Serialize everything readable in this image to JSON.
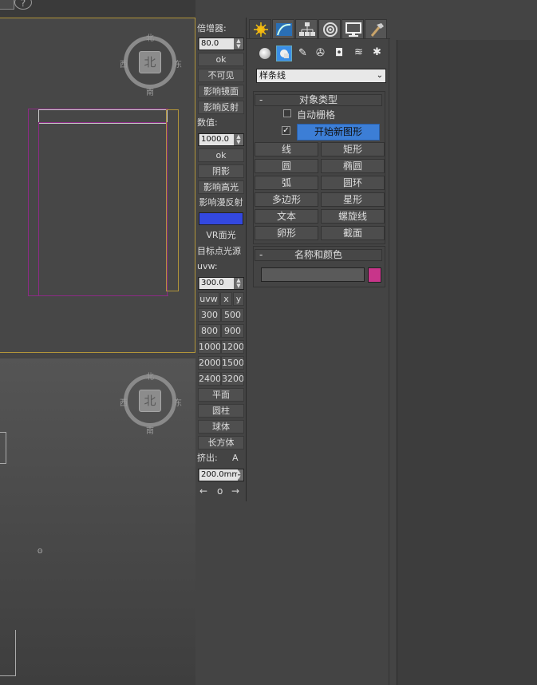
{
  "viewport_top": {
    "compass": {
      "center": "北",
      "north": "北",
      "south": "南",
      "east": "东",
      "west": "西"
    }
  },
  "viewport_bottom": {
    "compass": {
      "center": "北",
      "north": "北",
      "south": "南",
      "east": "东",
      "west": "西"
    }
  },
  "toolbar": {
    "multiplier_label": "倍增器:",
    "multiplier_value": "80.0",
    "ok1": "ok",
    "invisible": "不可见",
    "affect_specular_reflection": "影响镜面",
    "affect_reflection": "影响反射",
    "value_label": "数值:",
    "value_value": "1000.0",
    "ok2": "ok",
    "shadow": "阴影",
    "affect_highlight": "影响高光",
    "affect_diffuse": "影响漫反射",
    "swatch_color": "#3348e0",
    "vr_plane": "VR面光",
    "target_light": "目标点光源",
    "uvw_label": "uvw:",
    "uvw_value": "300.0",
    "uvw_btn": "uvw",
    "x_btn": "x",
    "y_btn": "y",
    "sizes": [
      [
        "300",
        "500"
      ],
      [
        "800",
        "900"
      ],
      [
        "1000",
        "1200"
      ],
      [
        "2000",
        "1500"
      ],
      [
        "2400",
        "3200"
      ]
    ],
    "plane": "平面",
    "cylinder": "圆柱",
    "sphere": "球体",
    "box": "长方体",
    "extrude_label": "挤出:",
    "extrude_a": "A",
    "extrude_value": "200.0mm",
    "arrow_left": "←",
    "arrow_o": "o",
    "arrow_right": "→"
  },
  "command_panel": {
    "tabs": [
      "create",
      "modify",
      "hierarchy",
      "motion",
      "display",
      "utilities"
    ],
    "active_tab": "create",
    "category_dropdown": "样条线",
    "object_type": {
      "title": "对象类型",
      "collapse": "-",
      "autogrid": "自动栅格",
      "start_new_shape": "开始新图形",
      "buttons": [
        [
          "线",
          "矩形"
        ],
        [
          "圆",
          "椭圆"
        ],
        [
          "弧",
          "圆环"
        ],
        [
          "多边形",
          "星形"
        ],
        [
          "文本",
          "螺旋线"
        ],
        [
          "卵形",
          "截面"
        ]
      ]
    },
    "name_color": {
      "title": "名称和颜色",
      "collapse": "-",
      "name_value": "",
      "color": "#c8358a"
    }
  }
}
